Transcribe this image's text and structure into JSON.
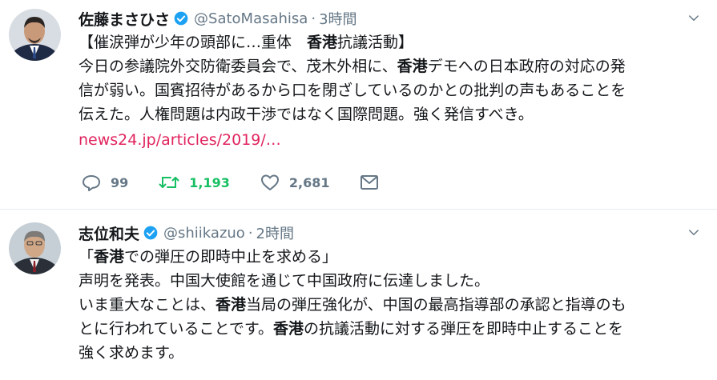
{
  "tweets": [
    {
      "name": "佐藤まさひさ",
      "handle": "@SatoMasahisa",
      "separator": "·",
      "time": "3時間",
      "lines": [
        [
          {
            "t": "【催涙弾が少年の頭部に…重体　"
          },
          {
            "t": "香港",
            "b": true
          },
          {
            "t": "抗議活動】"
          }
        ],
        [
          {
            "t": "今日の参議院外交防衛委員会で、茂木外相に、"
          },
          {
            "t": "香港",
            "b": true
          },
          {
            "t": "デモへの日本政府の対応の発"
          }
        ],
        [
          {
            "t": "信が弱い。国賓招待があるから口を閉ざしているのかとの批判の声もあることを"
          }
        ],
        [
          {
            "t": "伝えた。人権問題は内政干渉ではなく国際問題。強く発信すべき。"
          }
        ]
      ],
      "link": "news24.jp/articles/2019/…",
      "actions": {
        "replies": "99",
        "retweets": "1,193",
        "likes": "2,681"
      },
      "colors": {
        "link": "#e0245e",
        "retweet": "#17bf63"
      }
    },
    {
      "name": "志位和夫",
      "handle": "@shiikazuo",
      "separator": "·",
      "time": "2時間",
      "lines": [
        [
          {
            "t": "「"
          },
          {
            "t": "香港",
            "b": true
          },
          {
            "t": "での弾圧の即時中止を求める」"
          }
        ],
        [
          {
            "t": "声明を発表。中国大使館を通じて中国政府に伝達しました。"
          }
        ],
        [
          {
            "t": "いま重大なことは、"
          },
          {
            "t": "香港",
            "b": true
          },
          {
            "t": "当局の弾圧強化が、中国の最高指導部の承認と指導のも"
          }
        ],
        [
          {
            "t": "とに行われていることです。"
          },
          {
            "t": "香港",
            "b": true
          },
          {
            "t": "の抗議活動に対する弾圧を即時中止することを"
          }
        ],
        [
          {
            "t": "強く求めます。"
          }
        ]
      ]
    }
  ],
  "icons": {
    "verified": "verified-badge-icon",
    "caret": "chevron-down-icon",
    "reply": "reply-icon",
    "retweet": "retweet-icon",
    "like": "heart-icon",
    "dm": "envelope-icon"
  }
}
